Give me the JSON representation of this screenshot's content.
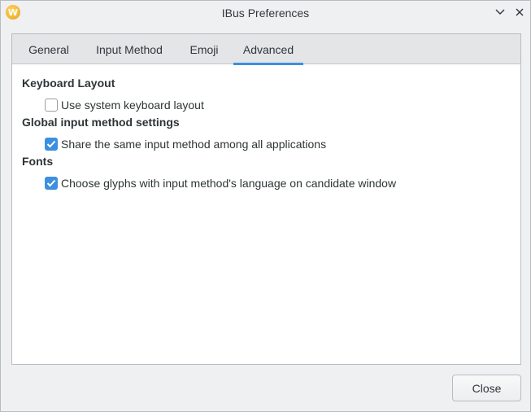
{
  "window": {
    "title": "IBus Preferences",
    "icon_letter": "W"
  },
  "tabs": [
    {
      "label": "General",
      "active": false
    },
    {
      "label": "Input Method",
      "active": false
    },
    {
      "label": "Emoji",
      "active": false
    },
    {
      "label": "Advanced",
      "active": true
    }
  ],
  "sections": [
    {
      "title": "Keyboard Layout",
      "option": {
        "label": "Use system keyboard layout",
        "checked": false
      }
    },
    {
      "title": "Global input method settings",
      "option": {
        "label": "Share the same input method among all applications",
        "checked": true
      }
    },
    {
      "title": "Fonts",
      "option": {
        "label": "Choose glyphs with input method's language on candidate window",
        "checked": true
      }
    }
  ],
  "footer": {
    "close_label": "Close"
  },
  "colors": {
    "accent": "#3d8fe0"
  },
  "icons": [
    "ibus-app-icon",
    "minimize-chevron-icon",
    "close-x-icon",
    "checkmark-icon"
  ]
}
